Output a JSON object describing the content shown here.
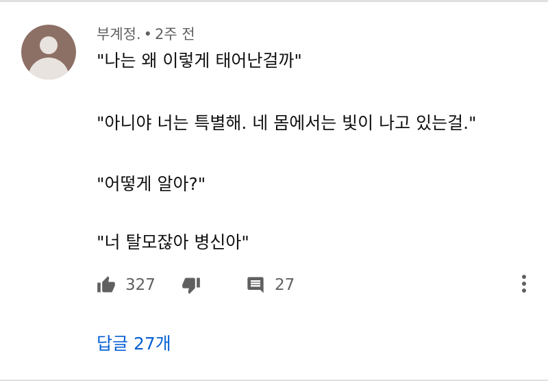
{
  "comment": {
    "author": "부계정.",
    "separator": "•",
    "time": "2주 전",
    "lines": [
      "\"나는 왜 이렇게 태어난걸까\"",
      "\"아니야 너는 특별해. 네 몸에서는 빛이 나고 있는걸.\"",
      "\"어떻게 알아?\"",
      "\"너 탈모잖아 병신아\""
    ]
  },
  "actions": {
    "like_icon": "thumbs-up-icon",
    "like_count": "327",
    "dislike_icon": "thumbs-down-icon",
    "reply_icon": "comment-icon",
    "reply_count": "27",
    "more_icon": "more-vert-icon"
  },
  "replies": {
    "label": "답글 27개"
  },
  "colors": {
    "text": "#0f0f0f",
    "meta": "#606060",
    "link": "#065fd4",
    "avatar_bg": "#8d7065"
  }
}
